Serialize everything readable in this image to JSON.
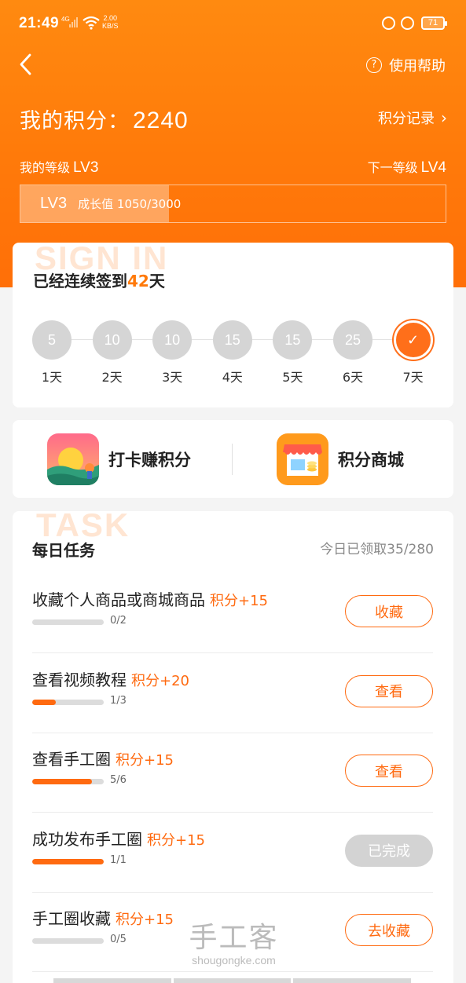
{
  "status_bar": {
    "time": "21:49",
    "network": "4G",
    "net_speed_value": "2.00",
    "net_speed_unit": "KB/S",
    "battery": "71"
  },
  "header": {
    "help_label": "使用帮助",
    "points_label": "我的积分：",
    "points_value": "2240",
    "records_label": "积分记录",
    "current_level_label": "我的等级",
    "current_level": "LV3",
    "next_level_label": "下一等级",
    "next_level": "LV4",
    "progress": {
      "level": "LV3",
      "label": "成长值",
      "value_text": "1050/3000",
      "value": 1050,
      "max": 3000
    }
  },
  "signin": {
    "watermark": "SIGN IN",
    "title_prefix": "已经连续签到",
    "days": "42",
    "title_suffix": "天",
    "schedule": [
      {
        "points": "5",
        "label": "1天",
        "done": false
      },
      {
        "points": "10",
        "label": "2天",
        "done": false
      },
      {
        "points": "10",
        "label": "3天",
        "done": false
      },
      {
        "points": "15",
        "label": "4天",
        "done": false
      },
      {
        "points": "15",
        "label": "5天",
        "done": false
      },
      {
        "points": "25",
        "label": "6天",
        "done": false
      },
      {
        "points": "✓",
        "label": "7天",
        "done": true
      }
    ]
  },
  "shortcuts": [
    {
      "label": "打卡赚积分",
      "icon": "checkin-sunrise-icon"
    },
    {
      "label": "积分商城",
      "icon": "shop-store-icon"
    }
  ],
  "tasks": {
    "watermark": "TASK",
    "title": "每日任务",
    "claimed": "今日已领取35/280",
    "items": [
      {
        "name": "收藏个人商品或商城商品",
        "points": "积分+15",
        "progress": "0/2",
        "fraction": 0,
        "button": "收藏",
        "completed": false
      },
      {
        "name": "查看视频教程",
        "points": "积分+20",
        "progress": "1/3",
        "fraction": 0.333,
        "button": "查看",
        "completed": false
      },
      {
        "name": "查看手工圈",
        "points": "积分+15",
        "progress": "5/6",
        "fraction": 0.833,
        "button": "查看",
        "completed": false
      },
      {
        "name": "成功发布手工圈",
        "points": "积分+15",
        "progress": "1/1",
        "fraction": 1,
        "button": "已完成",
        "completed": true
      },
      {
        "name": "手工圈收藏",
        "points": "积分+15",
        "progress": "0/5",
        "fraction": 0,
        "button": "去收藏",
        "completed": false
      }
    ]
  },
  "site_watermark": {
    "title": "手工客",
    "domain": "shougongke.com"
  },
  "colors": {
    "accent": "#ff7a0a",
    "accent_dark": "#ff6a10",
    "muted": "#d5d5d5"
  }
}
